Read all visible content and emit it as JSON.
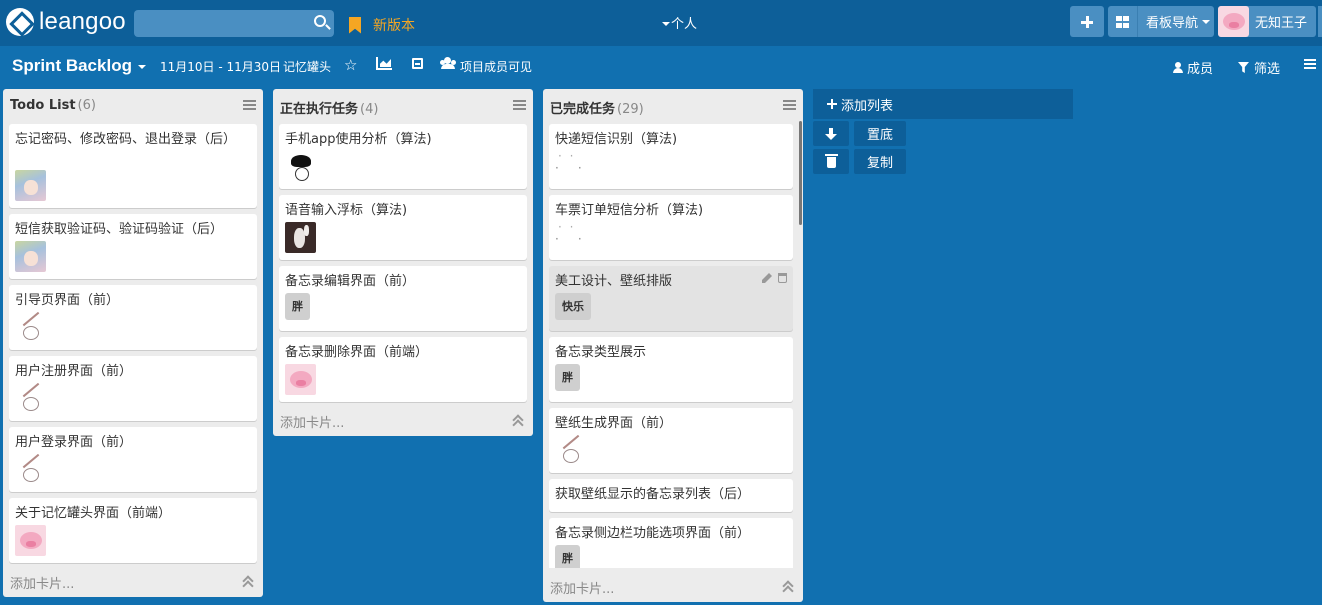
{
  "app": {
    "logo_text": "leangoo"
  },
  "topbar": {
    "search_placeholder": "",
    "new_version": "新版本",
    "personal": "个人",
    "board_nav": "看板导航",
    "username": "无知王子"
  },
  "board": {
    "title": "Sprint Backlog",
    "sprint_dates": "11月10日 - 11月30日",
    "sprint_name": "记忆罐头",
    "visibility": "项目成员可见",
    "members": "成员",
    "filter": "筛选"
  },
  "lists": [
    {
      "title": "Todo List",
      "count": "(6)",
      "add_card": "添加卡片...",
      "cards": [
        {
          "title": "忘记密码、修改密码、退出登录（后）",
          "avatar": "anime"
        },
        {
          "title": "短信获取验证码、验证码验证（后）",
          "avatar": "anime"
        },
        {
          "title": "引导页界面（前）",
          "avatar": "sketch"
        },
        {
          "title": "用户注册界面（前）",
          "avatar": "sketch"
        },
        {
          "title": "用户登录界面（前）",
          "avatar": "sketch"
        },
        {
          "title": "关于记忆罐头界面（前端）",
          "avatar": "pig"
        }
      ]
    },
    {
      "title": "正在执行任务",
      "count": "(4)",
      "add_card": "添加卡片...",
      "cards": [
        {
          "title": "手机app使用分析（算法)",
          "avatar": "ink"
        },
        {
          "title": "语音输入浮标（算法)",
          "avatar": "photo"
        },
        {
          "title": "备忘录编辑界面（前）",
          "tag": "胖"
        },
        {
          "title": "备忘录删除界面（前端）",
          "avatar": "pig"
        }
      ]
    },
    {
      "title": "已完成任务",
      "count": "(29)",
      "add_card": "添加卡片...",
      "cards": [
        {
          "title": "快递短信识别（算法)",
          "avatar": "loading"
        },
        {
          "title": "车票订单短信分析（算法)",
          "avatar": "loading"
        },
        {
          "title": "美工设计、壁纸排版",
          "tag": "快乐",
          "hover": true
        },
        {
          "title": "备忘录类型展示",
          "tag": "胖"
        },
        {
          "title": "壁纸生成界面（前）",
          "avatar": "sketch"
        },
        {
          "title": "获取壁纸显示的备忘录列表（后）"
        },
        {
          "title": "备忘录侧边栏功能选项界面（前）",
          "tag": "胖"
        }
      ]
    }
  ],
  "side_panel": {
    "add_list": "添加列表",
    "bottom_label": "置底",
    "copy_label": "复制"
  },
  "colors": {
    "background": "#1170b0",
    "topbar": "#0d5f99",
    "accent": "#f5a623",
    "list_bg": "#ececec"
  }
}
